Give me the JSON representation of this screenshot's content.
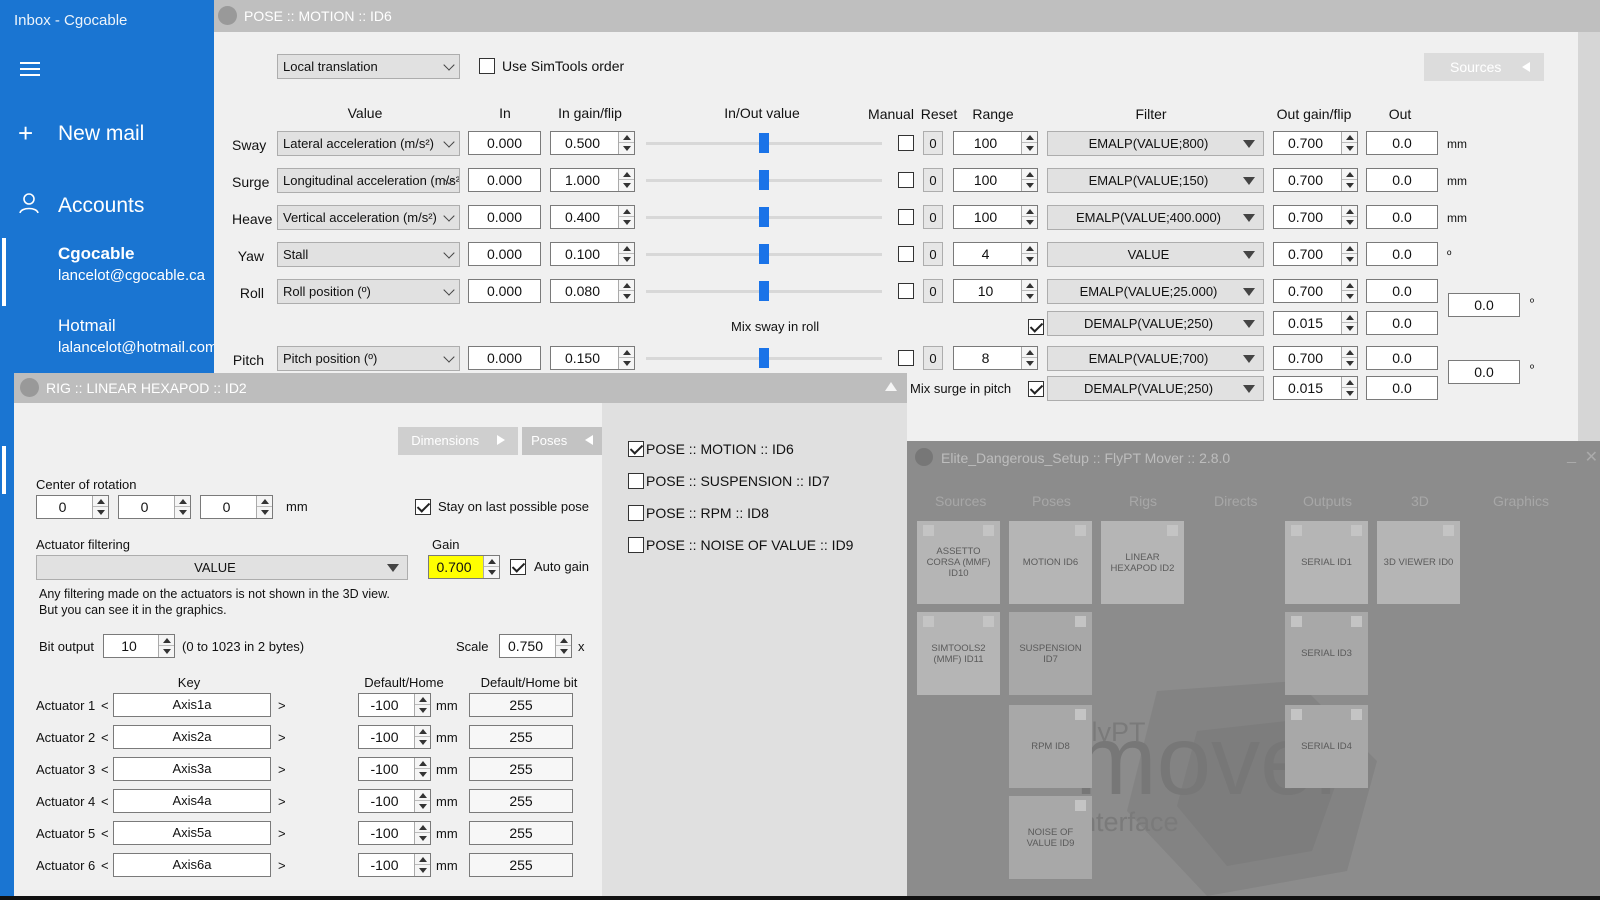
{
  "mail": {
    "window_title": "Inbox - Cgocable",
    "new_mail": "New mail",
    "accounts": "Accounts",
    "account_list": [
      {
        "name": "Cgocable",
        "email": "lancelot@cgocable.ca"
      },
      {
        "name": "Hotmail",
        "email": "lalancelot@hotmail.com"
      }
    ]
  },
  "pose": {
    "title": "POSE :: MOTION :: ID6",
    "mode": "Local translation",
    "simtools_label": "Use SimTools order",
    "sources_label": "Sources",
    "headers": {
      "value": "Value",
      "in": "In",
      "in_gain": "In gain/flip",
      "inout": "In/Out value",
      "manual": "Manual",
      "reset": "Reset",
      "range": "Range",
      "filter": "Filter",
      "out_gain": "Out gain/flip",
      "out": "Out"
    },
    "rows": [
      {
        "name": "Sway",
        "value": "Lateral acceleration (m/s²)",
        "in": "0.000",
        "gain": "0.500",
        "slider": 0.5,
        "reset": "0",
        "range": "100",
        "filter": "EMALP(VALUE;800)",
        "out_gain": "0.700",
        "out": "0.0",
        "unit": "mm"
      },
      {
        "name": "Surge",
        "value": "Longitudinal acceleration (m/s²)",
        "in": "0.000",
        "gain": "1.000",
        "slider": 0.5,
        "reset": "0",
        "range": "100",
        "filter": "EMALP(VALUE;150)",
        "out_gain": "0.700",
        "out": "0.0",
        "unit": "mm"
      },
      {
        "name": "Heave",
        "value": "Vertical acceleration (m/s²)",
        "in": "0.000",
        "gain": "0.400",
        "slider": 0.5,
        "reset": "0",
        "range": "100",
        "filter": "EMALP(VALUE;400.000)",
        "out_gain": "0.700",
        "out": "0.0",
        "unit": "mm"
      },
      {
        "name": "Yaw",
        "value": "Stall",
        "in": "0.000",
        "gain": "0.100",
        "slider": 0.5,
        "reset": "0",
        "range": "4",
        "filter": "VALUE",
        "out_gain": "0.700",
        "out": "0.0",
        "unit": "º"
      },
      {
        "name": "Roll",
        "value": "Roll position (º)",
        "in": "0.000",
        "gain": "0.080",
        "slider": 0.5,
        "reset": "0",
        "range": "10",
        "filter": "EMALP(VALUE;25.000)",
        "out_gain": "0.700",
        "out": "0.0",
        "unit": ""
      },
      {
        "name": "Pitch",
        "value": "Pitch position (º)",
        "in": "0.000",
        "gain": "0.150",
        "slider": 0.5,
        "reset": "0",
        "range": "8",
        "filter": "EMALP(VALUE;700)",
        "out_gain": "0.700",
        "out": "0.0",
        "unit": ""
      }
    ],
    "mix_sway": {
      "label": "Mix sway in roll",
      "filter": "DEMALP(VALUE;250)",
      "out_gain": "0.015",
      "out": "0.0",
      "total": "0.0",
      "unit": "º"
    },
    "mix_surge": {
      "label": "Mix surge in pitch",
      "filter": "DEMALP(VALUE;250)",
      "out_gain": "0.015",
      "out": "0.0",
      "total": "0.0",
      "unit": "º"
    }
  },
  "rig": {
    "title": "RIG :: LINEAR HEXAPOD :: ID2",
    "tab_dimensions": "Dimensions",
    "tab_poses": "Poses",
    "center_label": "Center of rotation",
    "center": [
      "0",
      "0",
      "0"
    ],
    "center_unit": "mm",
    "stay_label": "Stay on last possible pose",
    "filter_label": "Actuator filtering",
    "filter_value": "VALUE",
    "gain_label": "Gain",
    "gain_value": "0.700",
    "auto_gain": "Auto gain",
    "note1": "Any filtering made on the actuators is not shown in the 3D view.",
    "note2": "But you can see it in the graphics.",
    "bit_label": "Bit output",
    "bit_value": "10",
    "bit_note": "(0 to 1023 in 2 bytes)",
    "scale_label": "Scale",
    "scale_value": "0.750",
    "scale_unit": "x",
    "col_key": "Key",
    "col_default": "Default/Home",
    "col_bit": "Default/Home bit",
    "actuators": [
      {
        "label": "Actuator 1",
        "key": "Axis1a",
        "default": "-100",
        "bit": "255"
      },
      {
        "label": "Actuator 2",
        "key": "Axis2a",
        "default": "-100",
        "bit": "255"
      },
      {
        "label": "Actuator 3",
        "key": "Axis3a",
        "default": "-100",
        "bit": "255"
      },
      {
        "label": "Actuator 4",
        "key": "Axis4a",
        "default": "-100",
        "bit": "255"
      },
      {
        "label": "Actuator 5",
        "key": "Axis5a",
        "default": "-100",
        "bit": "255"
      },
      {
        "label": "Actuator 6",
        "key": "Axis6a",
        "default": "-100",
        "bit": "255"
      }
    ],
    "act_unit": "mm",
    "poses": [
      {
        "label": "POSE :: MOTION :: ID6",
        "checked": true
      },
      {
        "label": "POSE :: SUSPENSION :: ID7",
        "checked": false
      },
      {
        "label": "POSE :: RPM :: ID8",
        "checked": false
      },
      {
        "label": "POSE :: NOISE OF VALUE :: ID9",
        "checked": false
      }
    ]
  },
  "mover": {
    "title": "Elite_Dangerous_Setup :: FlyPT Mover :: 2.8.0",
    "tabs": [
      "Sources",
      "Poses",
      "Rigs",
      "Directs",
      "Outputs",
      "3D",
      "Graphics"
    ],
    "tiles": {
      "assetto": "ASSETTO CORSA (MMF) ID10",
      "simtools": "SIMTOOLS2 (MMF) ID11",
      "motion": "MOTION ID6",
      "suspension": "SUSPENSION ID7",
      "rpm": "RPM ID8",
      "noise": "NOISE OF VALUE ID9",
      "hexapod": "LINEAR HEXAPOD ID2",
      "serial1": "SERIAL ID1",
      "serial3": "SERIAL ID3",
      "serial4": "SERIAL ID4",
      "viewer": "3D VIEWER ID0"
    },
    "logo_small": "FlyPT",
    "logo_big": "mover",
    "logo_sub": "interface"
  }
}
